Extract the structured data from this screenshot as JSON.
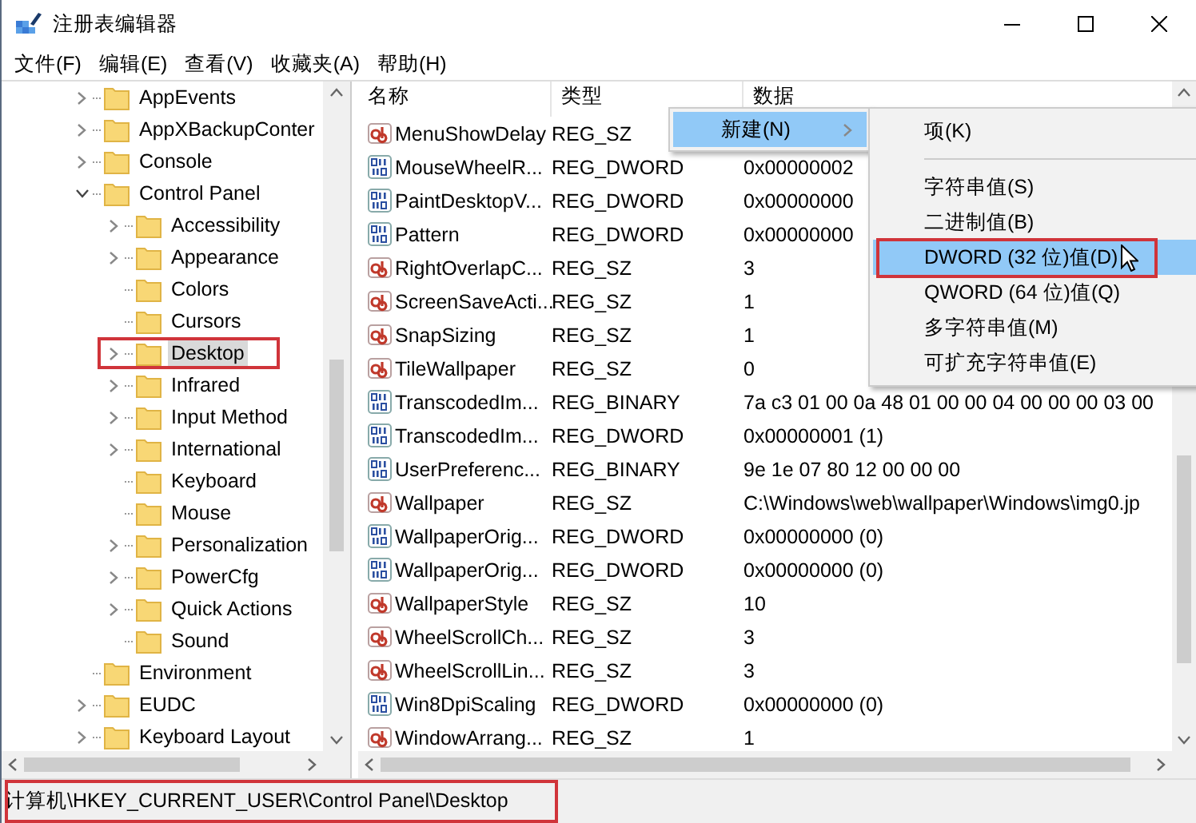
{
  "window": {
    "title": "注册表编辑器"
  },
  "menu_bar": [
    "文件(F)",
    "编辑(E)",
    "查看(V)",
    "收藏夹(A)",
    "帮助(H)"
  ],
  "tree": [
    {
      "label": "AppEvents",
      "expandable": true,
      "expanded": false,
      "selected": false
    },
    {
      "label": "AppXBackupConter",
      "expandable": true,
      "expanded": false,
      "selected": false
    },
    {
      "label": "Console",
      "expandable": true,
      "expanded": false,
      "selected": false
    },
    {
      "label": "Control Panel",
      "expandable": true,
      "expanded": true,
      "selected": false,
      "children": [
        {
          "label": "Accessibility",
          "expandable": true,
          "expanded": false,
          "selected": false
        },
        {
          "label": "Appearance",
          "expandable": true,
          "expanded": false,
          "selected": false
        },
        {
          "label": "Colors",
          "expandable": false,
          "selected": false
        },
        {
          "label": "Cursors",
          "expandable": false,
          "selected": false
        },
        {
          "label": "Desktop",
          "expandable": true,
          "expanded": false,
          "selected": true,
          "highlighted": true
        },
        {
          "label": "Infrared",
          "expandable": true,
          "expanded": false,
          "selected": false
        },
        {
          "label": "Input Method",
          "expandable": true,
          "expanded": false,
          "selected": false
        },
        {
          "label": "International",
          "expandable": true,
          "expanded": false,
          "selected": false
        },
        {
          "label": "Keyboard",
          "expandable": false,
          "selected": false
        },
        {
          "label": "Mouse",
          "expandable": false,
          "selected": false
        },
        {
          "label": "Personalization",
          "expandable": true,
          "expanded": false,
          "selected": false
        },
        {
          "label": "PowerCfg",
          "expandable": true,
          "expanded": false,
          "selected": false
        },
        {
          "label": "Quick Actions",
          "expandable": true,
          "expanded": false,
          "selected": false
        },
        {
          "label": "Sound",
          "expandable": false,
          "selected": false
        }
      ]
    },
    {
      "label": "Environment",
      "expandable": false,
      "selected": false
    },
    {
      "label": "EUDC",
      "expandable": true,
      "expanded": false,
      "selected": false
    },
    {
      "label": "Keyboard Layout",
      "expandable": true,
      "expanded": false,
      "selected": false
    }
  ],
  "columns": [
    "名称",
    "类型",
    "数据"
  ],
  "rows": [
    {
      "kind": "string",
      "name": "MenuShowDelay",
      "type": "REG_SZ"
    },
    {
      "kind": "binary",
      "name": "MouseWheelR...",
      "type": "REG_DWORD",
      "data": "0x00000002"
    },
    {
      "kind": "binary",
      "name": "PaintDesktopV...",
      "type": "REG_DWORD",
      "data": "0x00000000"
    },
    {
      "kind": "binary",
      "name": "Pattern",
      "type": "REG_DWORD",
      "data": "0x00000000"
    },
    {
      "kind": "string",
      "name": "RightOverlapC...",
      "type": "REG_SZ",
      "data": "3"
    },
    {
      "kind": "string",
      "name": "ScreenSaveActi...",
      "type": "REG_SZ",
      "data": "1"
    },
    {
      "kind": "string",
      "name": "SnapSizing",
      "type": "REG_SZ",
      "data": "1"
    },
    {
      "kind": "string",
      "name": "TileWallpaper",
      "type": "REG_SZ",
      "data": "0"
    },
    {
      "kind": "binary",
      "name": "TranscodedIm...",
      "type": "REG_BINARY",
      "data": "7a c3 01 00 0a 48 01 00 00 04 00 00 00 03 00"
    },
    {
      "kind": "binary",
      "name": "TranscodedIm...",
      "type": "REG_DWORD",
      "data": "0x00000001 (1)"
    },
    {
      "kind": "binary",
      "name": "UserPreferenc...",
      "type": "REG_BINARY",
      "data": "9e 1e 07 80 12 00 00 00"
    },
    {
      "kind": "string",
      "name": "Wallpaper",
      "type": "REG_SZ",
      "data": "C:\\Windows\\web\\wallpaper\\Windows\\img0.jp"
    },
    {
      "kind": "binary",
      "name": "WallpaperOrig...",
      "type": "REG_DWORD",
      "data": "0x00000000 (0)"
    },
    {
      "kind": "binary",
      "name": "WallpaperOrig...",
      "type": "REG_DWORD",
      "data": "0x00000000 (0)"
    },
    {
      "kind": "string",
      "name": "WallpaperStyle",
      "type": "REG_SZ",
      "data": "10"
    },
    {
      "kind": "string",
      "name": "WheelScrollCh...",
      "type": "REG_SZ",
      "data": "3"
    },
    {
      "kind": "string",
      "name": "WheelScrollLin...",
      "type": "REG_SZ",
      "data": "3"
    },
    {
      "kind": "binary",
      "name": "Win8DpiScaling",
      "type": "REG_DWORD",
      "data": "0x00000000 (0)"
    },
    {
      "kind": "string",
      "name": "WindowArrang...",
      "type": "REG_SZ",
      "data": "1"
    }
  ],
  "context_menu": {
    "items": [
      {
        "label": "新建(N)",
        "submenu": true,
        "selected": true
      }
    ]
  },
  "submenu": {
    "items": [
      {
        "kind": "item",
        "label": "项(K)",
        "selected": false
      },
      {
        "kind": "separator"
      },
      {
        "kind": "item",
        "label": "字符串值(S)",
        "selected": false
      },
      {
        "kind": "item",
        "label": "二进制值(B)",
        "selected": false
      },
      {
        "kind": "item",
        "label": "DWORD (32 位)值(D)",
        "selected": true,
        "highlighted": true,
        "pointer": true
      },
      {
        "kind": "item",
        "label": "QWORD (64 位)值(Q)",
        "selected": false
      },
      {
        "kind": "item",
        "label": "多字符串值(M)",
        "selected": false
      },
      {
        "kind": "item",
        "label": "可扩充字符串值(E)",
        "selected": false
      }
    ]
  },
  "status_bar": {
    "text": "计算机\\HKEY_CURRENT_USER\\Control Panel\\Desktop",
    "highlighted": true
  }
}
